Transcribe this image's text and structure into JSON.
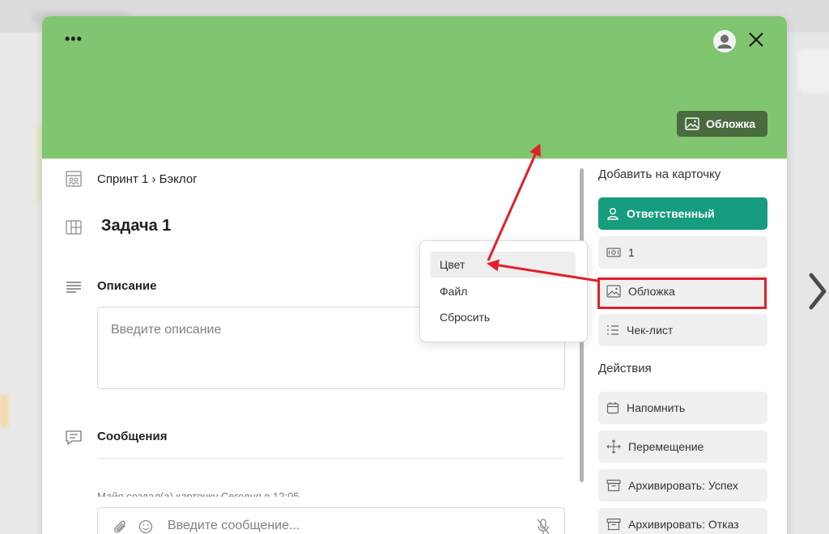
{
  "cover": {
    "color": "#80c56f",
    "cover_button_label": "Обложка"
  },
  "breadcrumb": {
    "text": "Спринт 1 › Бэклог"
  },
  "task": {
    "title": "Задача 1"
  },
  "description": {
    "label": "Описание",
    "placeholder": "Введите описание"
  },
  "messages": {
    "label": "Сообщения",
    "partial_text": "Майя создал(а) карточку Сегодня в 12:05",
    "input_placeholder": "Введите сообщение..."
  },
  "popup_menu": {
    "items": [
      {
        "label": "Цвет",
        "active": true
      },
      {
        "label": "Файл",
        "active": false
      },
      {
        "label": "Сбросить",
        "active": false
      }
    ]
  },
  "right_panel": {
    "add_heading": "Добавить на карточку",
    "add_buttons": [
      {
        "label": "Ответственный",
        "icon": "user-icon"
      },
      {
        "label": "1",
        "icon": "money-icon"
      },
      {
        "label": "Обложка",
        "icon": "image-icon"
      },
      {
        "label": "Чек-лист",
        "icon": "checklist-icon"
      }
    ],
    "actions_heading": "Действия",
    "action_buttons": [
      {
        "label": "Напомнить",
        "icon": "calendar-icon"
      },
      {
        "label": "Перемещение",
        "icon": "move-icon"
      },
      {
        "label": "Архивировать: Успех",
        "icon": "archive-icon"
      },
      {
        "label": "Архивировать: Отказ",
        "icon": "archive-icon"
      }
    ]
  },
  "colors": {
    "accent_green": "#169c7f",
    "annotation_red": "#e0202a"
  }
}
